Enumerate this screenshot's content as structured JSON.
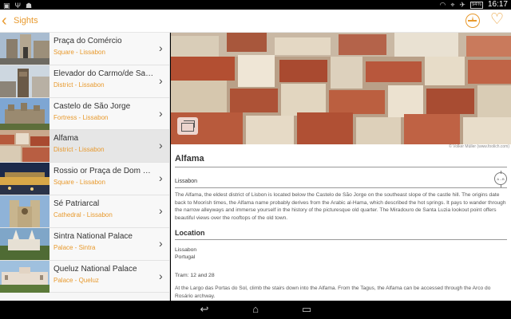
{
  "status": {
    "icons": [
      "image-icon",
      "usb-icon",
      "android-icon"
    ],
    "battery": "94%",
    "time": "16:17"
  },
  "appbar": {
    "title": "Sights"
  },
  "sights": [
    {
      "name": "Praça do Comércio",
      "sub": "Square - Lissabon"
    },
    {
      "name": "Elevador do Carmo/de Santa Justa",
      "sub": "District - Lissabon"
    },
    {
      "name": "Castelo de São Jorge",
      "sub": "Fortress - Lissabon"
    },
    {
      "name": "Alfama",
      "sub": "District - Lissabon",
      "selected": true
    },
    {
      "name": "Rossio or Praça de Dom Pedro IV",
      "sub": "Square - Lissabon"
    },
    {
      "name": "Sé Patriarcal",
      "sub": "Cathedral - Lissabon"
    },
    {
      "name": "Sintra National Palace",
      "sub": "Palace - Sintra"
    },
    {
      "name": "Queluz National Palace",
      "sub": "Palace - Queluz"
    }
  ],
  "detail": {
    "photo_credit": "© Volker Müller (www.foolich.com)",
    "title": "Alfama",
    "city": "Lissabon",
    "distance_label": "A→B",
    "description": "The Alfama, the eldest district of Lisbon is located below the Castelo de São Jorge on the southeast slope of the castle hill. The origins date back to Moorish times, the Alfama name probably derives from the Arabic al-Hama, which described the hot springs. It pays to wander through the narrow alleyways and immerse yourself in the history of the picturesque old quarter. The Miradouro de Santa Luzia lookout point offers beautiful views over the rooftops of the old town.",
    "location_heading": "Location",
    "location_city": "Lissabon",
    "location_country": "Portugal",
    "tram": "Tram: 12 and 28",
    "directions": "At the Largo das Portas do Sol, climb the stairs down into the Alfama. From the Tagus, the Alfama can be accessed through the Arco do Rosário archway."
  },
  "navbar": {
    "back": "back-icon",
    "home": "home-icon",
    "recents": "recents-icon"
  }
}
